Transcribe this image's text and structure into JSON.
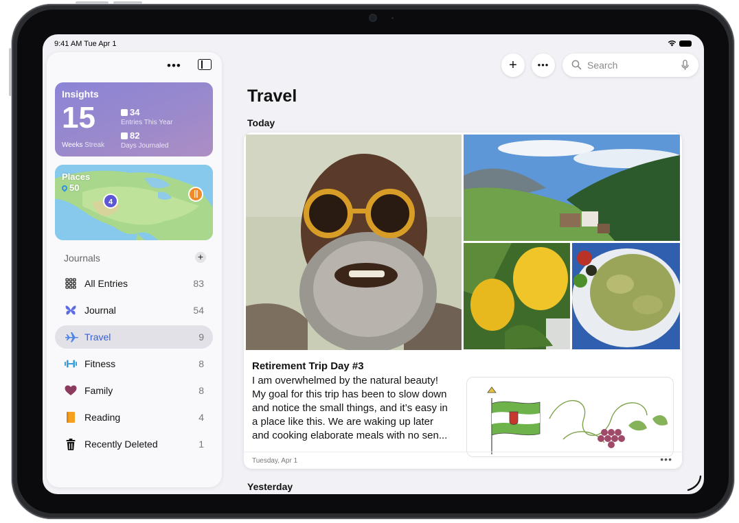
{
  "status": {
    "time": "9:41 AM  Tue Apr 1"
  },
  "sidebar": {
    "insights": {
      "title": "Insights",
      "streak_value": "15",
      "streak_label": "Weeks",
      "streak_sub": "Streak",
      "entries_value": "34",
      "entries_label": "Entries This Year",
      "days_value": "82",
      "days_label": "Days Journaled"
    },
    "places": {
      "title": "Places",
      "count": "50",
      "pin_cluster": "4"
    },
    "journals_header": "Journals",
    "items": [
      {
        "label": "All Entries",
        "count": "83",
        "icon": "grid-icon"
      },
      {
        "label": "Journal",
        "count": "54",
        "icon": "butterfly-icon"
      },
      {
        "label": "Travel",
        "count": "9",
        "icon": "airplane-icon",
        "active": true
      },
      {
        "label": "Fitness",
        "count": "8",
        "icon": "dumbbell-icon"
      },
      {
        "label": "Family",
        "count": "8",
        "icon": "heart-icon"
      },
      {
        "label": "Reading",
        "count": "4",
        "icon": "book-icon"
      },
      {
        "label": "Recently Deleted",
        "count": "1",
        "icon": "trash-icon"
      }
    ]
  },
  "toolbar": {
    "add_label": "+",
    "more_label": "•••",
    "search_placeholder": "Search"
  },
  "main": {
    "title": "Travel",
    "sections": [
      "Today",
      "Yesterday"
    ],
    "entry": {
      "title": "Retirement Trip Day #3",
      "body_lines": [
        "I am overwhelmed by the natural beauty!",
        "My goal for this trip has been to slow down",
        "and notice the small things, and it’s easy in",
        "a place like this. We are waking up later",
        "and cooking elaborate meals with no sen..."
      ],
      "date": "Tuesday, Apr 1"
    }
  },
  "colors": {
    "accent": "#3560d8",
    "insights_gradient_start": "#8b84d6",
    "insights_gradient_end": "#ad8ec3"
  }
}
